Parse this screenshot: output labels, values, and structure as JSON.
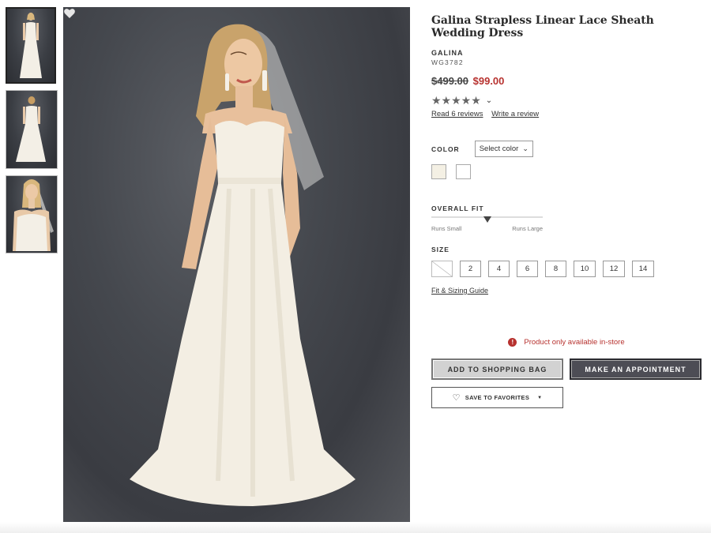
{
  "product": {
    "title": "Galina Strapless Linear Lace Sheath Wedding Dress",
    "brand": "GALINA",
    "sku": "WG3782",
    "original_price": "$499.00",
    "sale_price": "$99.00",
    "rating_stars": "★★★★★",
    "rating_chevron": "⌄",
    "read_reviews": "Read 6 reviews",
    "write_review": "Write a review"
  },
  "color": {
    "label": "COLOR",
    "select_placeholder": "Select color",
    "select_caret": "⌄",
    "swatches": [
      "#f4f0e4",
      "#ffffff"
    ]
  },
  "fit": {
    "label": "OVERALL FIT",
    "left_label": "Runs Small",
    "right_label": "Runs Large",
    "level": 0.5
  },
  "size": {
    "label": "SIZE",
    "options": [
      "2",
      "4",
      "6",
      "8",
      "10",
      "12",
      "14"
    ],
    "guide_link": "Fit & Sizing Guide"
  },
  "availability": {
    "icon": "!",
    "message": "Product only available in-store"
  },
  "actions": {
    "add_to_bag": "ADD TO SHOPPING BAG",
    "appointment": "MAKE AN APPOINTMENT",
    "save_favorites": "SAVE TO FAVORITES",
    "fav_heart": "♡",
    "fav_drop": "▼"
  },
  "colors": {
    "sale_red": "#b7322f",
    "dark_button": "#4d4d55",
    "light_button": "#d2d2d2"
  }
}
